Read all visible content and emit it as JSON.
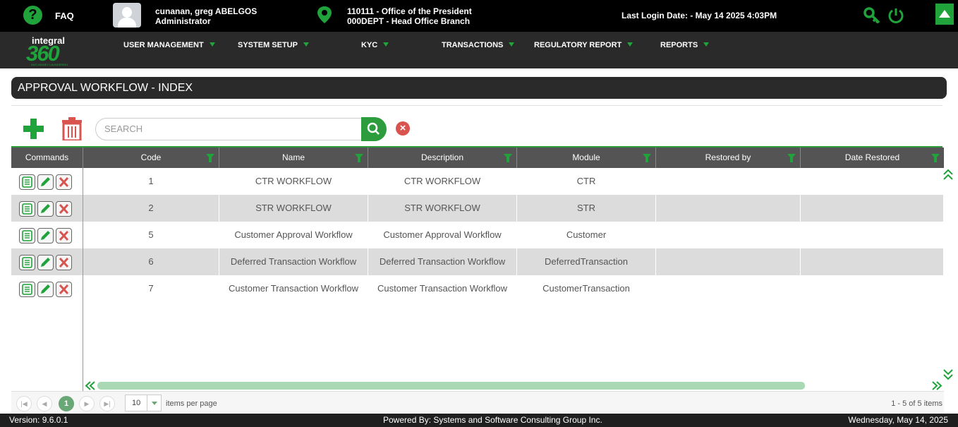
{
  "topbar": {
    "help_icon": "?",
    "faq": "FAQ",
    "user_name": "cunanan, greg ABELGOS",
    "user_role": "Administrator",
    "office_line1": "110111 - Office of the President",
    "office_line2": "000DEPT - Head Office Branch",
    "last_login": "Last Login Date: - May 14 2025 4:03PM"
  },
  "logo": {
    "top": "integral",
    "main": "360",
    "tag": "ANTI-MONEY LAUNDERING"
  },
  "menu": {
    "user_management": "USER MANAGEMENT",
    "system_setup": "SYSTEM SETUP",
    "kyc": "KYC",
    "transactions": "TRANSACTIONS",
    "regulatory_report": "REGULATORY REPORT",
    "reports": "REPORTS"
  },
  "page": {
    "title": "APPROVAL WORKFLOW - INDEX"
  },
  "toolbar": {
    "search_placeholder": "SEARCH",
    "clear_icon": "×"
  },
  "grid": {
    "headers": {
      "commands": "Commands",
      "code": "Code",
      "name": "Name",
      "description": "Description",
      "module": "Module",
      "restored_by": "Restored by",
      "date_restored": "Date Restored"
    },
    "rows": [
      {
        "code": "1",
        "name": "CTR WORKFLOW",
        "description": "CTR WORKFLOW",
        "module": "CTR",
        "restored_by": "",
        "date_restored": ""
      },
      {
        "code": "2",
        "name": "STR WORKFLOW",
        "description": "STR WORKFLOW",
        "module": "STR",
        "restored_by": "",
        "date_restored": ""
      },
      {
        "code": "5",
        "name": "Customer Approval Workflow",
        "description": "Customer Approval Workflow",
        "module": "Customer",
        "restored_by": "",
        "date_restored": ""
      },
      {
        "code": "6",
        "name": "Deferred Transaction Workflow",
        "description": "Deferred Transaction Workflow",
        "module": "DeferredTransaction",
        "restored_by": "",
        "date_restored": ""
      },
      {
        "code": "7",
        "name": "Customer Transaction Workflow",
        "description": "Customer Transaction Workflow",
        "module": "CustomerTransaction",
        "restored_by": "",
        "date_restored": ""
      }
    ]
  },
  "pager": {
    "current_page": "1",
    "page_size": "10",
    "items_per_page": "items per page",
    "summary": "1 - 5 of 5 items"
  },
  "footer": {
    "version": "Version: 9.6.0.1",
    "powered_by": "Powered By: Systems and Software Consulting Group Inc.",
    "date": "Wednesday, May 14, 2025"
  },
  "colors": {
    "accent": "#1fa33a",
    "header": "#545454",
    "alt_row": "#dcdcdc",
    "delete": "#d9534f"
  }
}
